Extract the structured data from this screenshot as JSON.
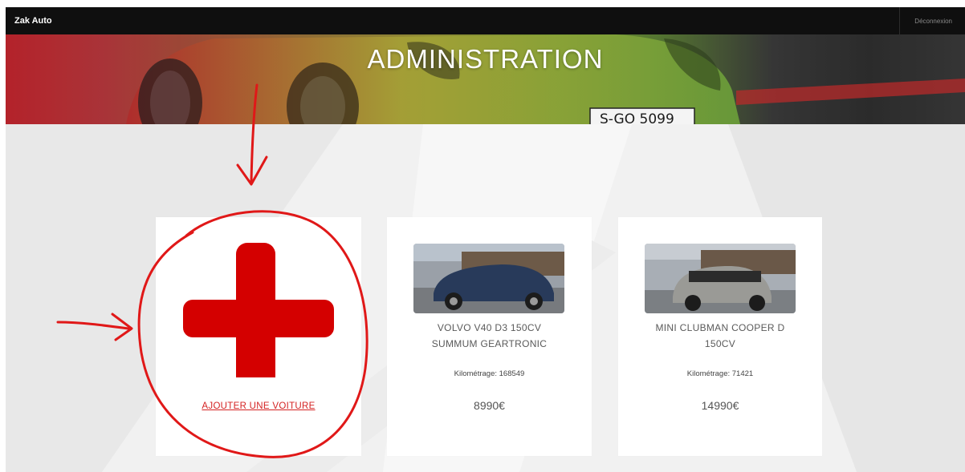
{
  "navbar": {
    "brand": "Zak Auto",
    "logout": "Déconnexion"
  },
  "hero": {
    "title": "ADMINISTRATION",
    "plate": "S-GO 5099"
  },
  "add_card": {
    "icon": "plus-icon",
    "link": "AJOUTER UNE VOITURE",
    "accent": "#d40000"
  },
  "cars": [
    {
      "name_line1": "VOLVO V40 D3 150CV",
      "name_line2": "SUMMUM GEARTRONIC",
      "mileage": "Kilométrage: 168549",
      "price": "8990€",
      "color": "#283a5a"
    },
    {
      "name_line1": "MINI CLUBMAN COOPER D",
      "name_line2": "150CV",
      "mileage": "Kilométrage: 71421",
      "price": "14990€",
      "color": "#9a9a96"
    }
  ],
  "annotation": {
    "color": "#e01818"
  }
}
